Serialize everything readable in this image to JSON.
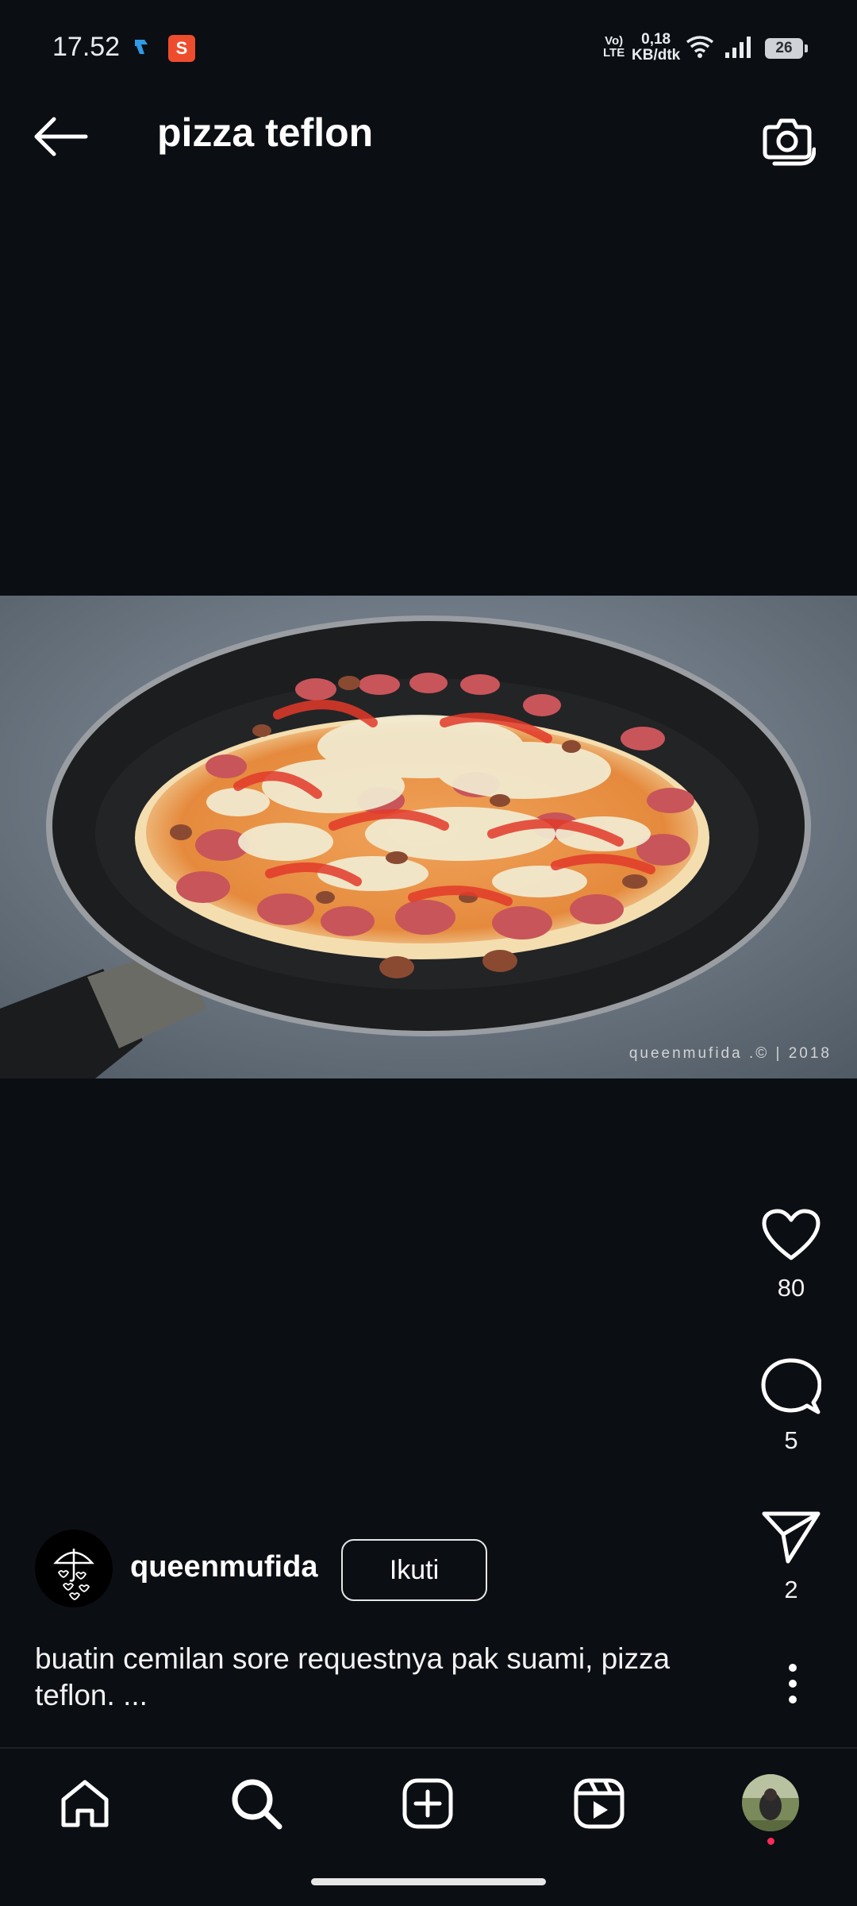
{
  "status_bar": {
    "time": "17.52",
    "volte_line1": "Vo)",
    "volte_line2": "LTE",
    "speed_value": "0,18",
    "speed_unit": "KB/dtk",
    "battery": "26"
  },
  "header": {
    "title": "pizza teflon",
    "back_icon": "arrow-left-icon",
    "camera_icon": "camera-icon"
  },
  "post": {
    "watermark": "queenmufida .© | 2018",
    "likes": "80",
    "comments": "5",
    "shares": "2",
    "username": "queenmufida",
    "follow_label": "Ikuti",
    "caption": "buatin cemilan sore requestnya pak suami, pizza teflon. ..."
  },
  "bottom_nav": {
    "items": [
      "home-icon",
      "search-icon",
      "add-post-icon",
      "reels-icon",
      "profile-avatar"
    ]
  },
  "colors": {
    "background": "#0b0e13",
    "notification_dot": "#ff2a55",
    "shopee_orange": "#ee4d2d"
  }
}
